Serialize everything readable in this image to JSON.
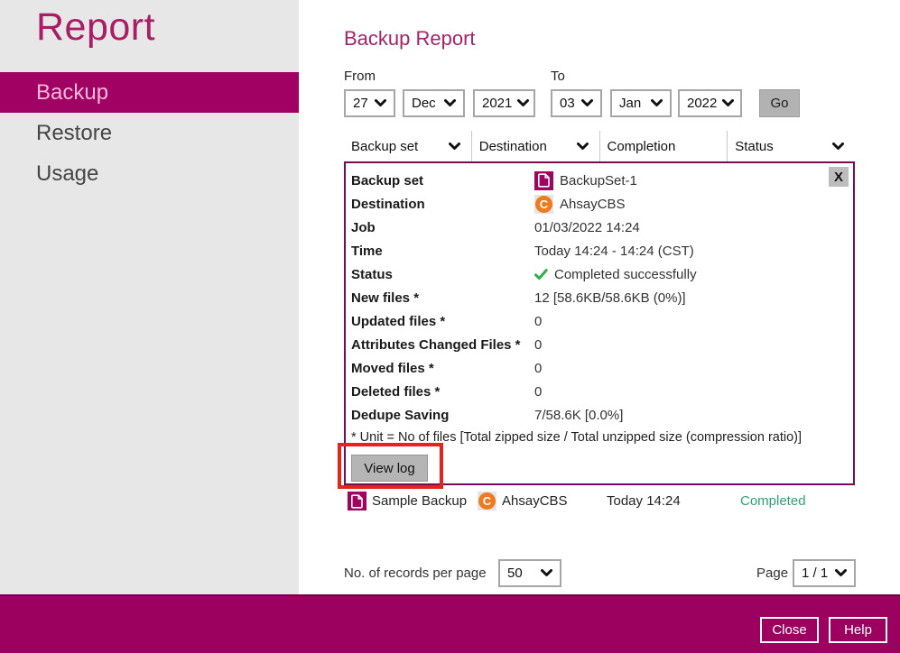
{
  "sidebar": {
    "title": "Report",
    "items": [
      {
        "label": "Backup",
        "selected": true
      },
      {
        "label": "Restore",
        "selected": false
      },
      {
        "label": "Usage",
        "selected": false
      }
    ]
  },
  "header": {
    "title": "Backup Report"
  },
  "date_filter": {
    "from_label": "From",
    "to_label": "To",
    "from": {
      "day": "27",
      "month": "Dec",
      "year": "2021"
    },
    "to": {
      "day": "03",
      "month": "Jan",
      "year": "2022"
    },
    "go_label": "Go"
  },
  "filter_bar": {
    "columns": [
      {
        "label": "Backup set"
      },
      {
        "label": "Destination"
      },
      {
        "label": "Completion"
      },
      {
        "label": "Status"
      }
    ]
  },
  "detail_panel": {
    "close_label": "X",
    "rows": [
      {
        "label": "Backup set",
        "value": "BackupSet-1",
        "icon": "backup-set-icon"
      },
      {
        "label": "Destination",
        "value": "AhsayCBS",
        "icon": "ahsaycbs-icon"
      },
      {
        "label": "Job",
        "value": "01/03/2022 14:24"
      },
      {
        "label": "Time",
        "value": "Today 14:24 - 14:24 (CST)"
      },
      {
        "label": "Status",
        "value": "Completed successfully",
        "icon": "check-icon"
      },
      {
        "label": "New files *",
        "value": "12 [58.6KB/58.6KB (0%)]"
      },
      {
        "label": "Updated files *",
        "value": "0"
      },
      {
        "label": "Attributes Changed Files *",
        "value": "0"
      },
      {
        "label": "Moved files *",
        "value": "0"
      },
      {
        "label": "Deleted files *",
        "value": "0"
      },
      {
        "label": "Dedupe Saving",
        "value": "7/58.6K [0.0%]"
      }
    ],
    "footnote": "* Unit = No of files [Total zipped size / Total unzipped size (compression ratio)]",
    "view_log_label": "View log"
  },
  "result_row": {
    "backup_set": "Sample Backup",
    "destination": "AhsayCBS",
    "time": "Today 14:24",
    "status": "Completed"
  },
  "pagination": {
    "records_label": "No. of records per page",
    "records_value": "50",
    "page_label": "Page",
    "page_value": "1 / 1"
  },
  "footer": {
    "close_label": "Close",
    "help_label": "Help"
  },
  "colors": {
    "brand_magenta": "#a00162",
    "panel_border": "#7d0a56",
    "status_check_green": "#2fae4e",
    "completed_green": "#2ea273",
    "annotation_red": "#e3251c",
    "cbs_orange": "#ee7b1d",
    "sidebar_gray": "#e7e7e7"
  }
}
